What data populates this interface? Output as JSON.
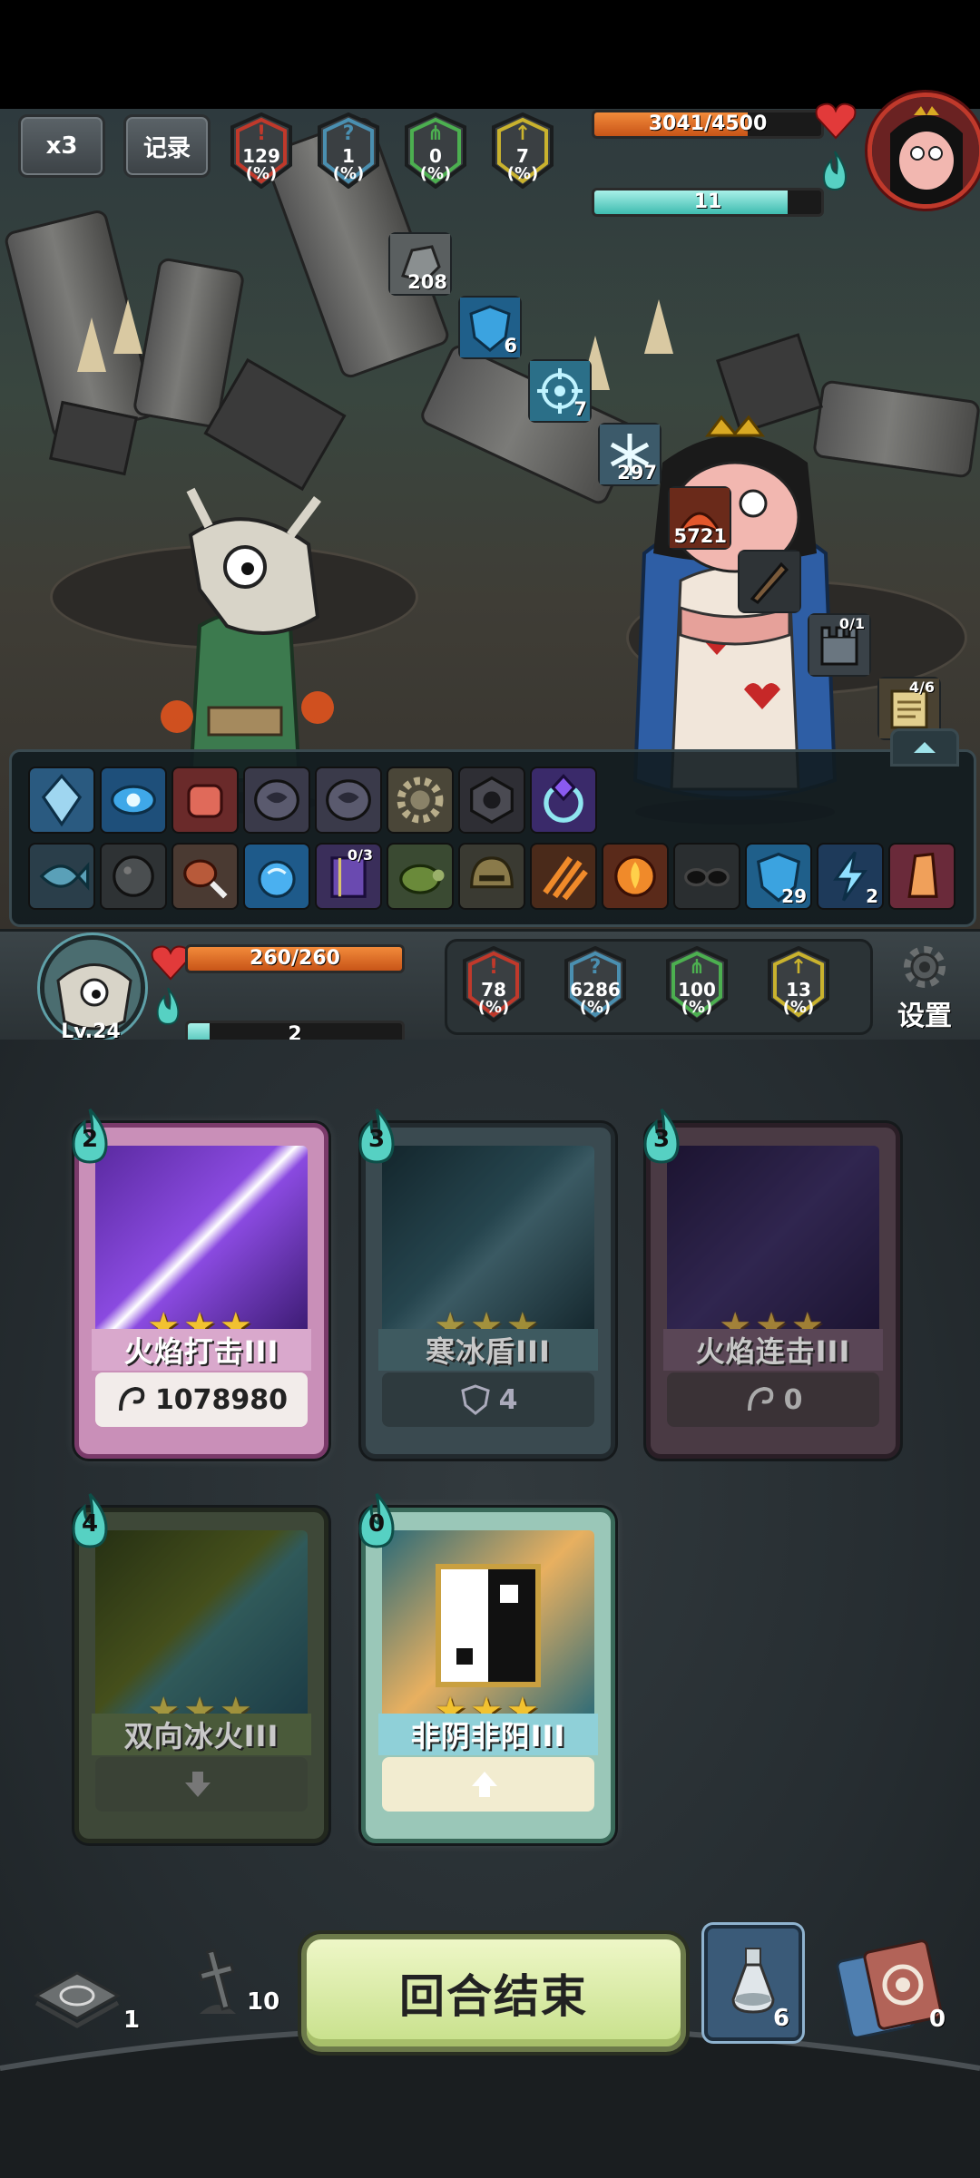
{
  "top": {
    "speed_label": "x3",
    "record_label": "记录",
    "enemy_stats": [
      {
        "value": "129",
        "unit": "(%)",
        "color": "#c0392b"
      },
      {
        "value": "1",
        "unit": "(%)",
        "color": "#4a8fb0"
      },
      {
        "value": "0",
        "unit": "(%)",
        "color": "#4caf50"
      },
      {
        "value": "7",
        "unit": "(%)",
        "color": "#c9b22e"
      }
    ],
    "enemy_hp": "3041/4500",
    "enemy_hp_fraction": 0.676,
    "enemy_energy": "11",
    "enemy_energy_fraction": 0.85,
    "enemy_buffs": [
      {
        "icon": "stone-icon",
        "value": "208",
        "top": ""
      },
      {
        "icon": "shield-icon",
        "value": "6",
        "top": ""
      },
      {
        "icon": "target-icon",
        "value": "7",
        "top": ""
      },
      {
        "icon": "snowflake-icon",
        "value": "297",
        "top": ""
      },
      {
        "icon": "fire-bird-icon",
        "value": "5721",
        "top": ""
      },
      {
        "icon": "dagger-icon",
        "value": "",
        "top": ""
      },
      {
        "icon": "castle-icon",
        "value": "",
        "top": "0/1"
      },
      {
        "icon": "scroll-icon",
        "value": "",
        "top": "4/6"
      }
    ]
  },
  "skills": {
    "row1": [
      "crystal-icon",
      "eye-icon",
      "fist-icon",
      "rune-icon",
      "rune-icon",
      "gear-rune-icon",
      "dark-rune-icon",
      "gem-ring-icon"
    ],
    "row2": [
      {
        "icon": "fish-icon",
        "value": "",
        "top": ""
      },
      {
        "icon": "ball-icon",
        "value": "",
        "top": ""
      },
      {
        "icon": "meat-icon",
        "value": "",
        "top": ""
      },
      {
        "icon": "water-icon",
        "value": "",
        "top": ""
      },
      {
        "icon": "book-icon",
        "value": "",
        "top": "0/3"
      },
      {
        "icon": "turtle-icon",
        "value": "",
        "top": ""
      },
      {
        "icon": "helmet-icon",
        "value": "",
        "top": ""
      },
      {
        "icon": "claw-icon",
        "value": "",
        "top": ""
      },
      {
        "icon": "burn-icon",
        "value": "",
        "top": ""
      },
      {
        "icon": "glasses-icon",
        "value": "",
        "top": ""
      },
      {
        "icon": "shield-icon",
        "value": "29",
        "top": ""
      },
      {
        "icon": "lightning-icon",
        "value": "2",
        "top": ""
      },
      {
        "icon": "crystal-shard-icon",
        "value": "",
        "top": ""
      }
    ]
  },
  "player": {
    "level": "Lv.24",
    "hp": "260/260",
    "hp_fraction": 1.0,
    "energy": "2",
    "energy_fraction": 0.1,
    "stats": [
      {
        "value": "78",
        "unit": "(%)",
        "color": "#c0392b"
      },
      {
        "value": "6286",
        "unit": "(%)",
        "color": "#4a8fb0"
      },
      {
        "value": "100",
        "unit": "(%)",
        "color": "#4caf50"
      },
      {
        "value": "13",
        "unit": "(%)",
        "color": "#c9b22e"
      }
    ],
    "settings_label": "设置"
  },
  "cards": [
    {
      "cost": "2",
      "name": "火焰打击III",
      "stat": "1078980",
      "stat_icon": "fist-icon",
      "theme": "purple"
    },
    {
      "cost": "3",
      "name": "寒冰盾III",
      "stat": "4",
      "stat_icon": "shield-icon",
      "theme": "teal-dim"
    },
    {
      "cost": "3",
      "name": "火焰连击III",
      "stat": "0",
      "stat_icon": "fist-icon",
      "theme": "purple-dim"
    },
    {
      "cost": "4",
      "name": "双向冰火III",
      "stat": "",
      "stat_icon": "arrow-down-icon",
      "theme": "green-dim"
    },
    {
      "cost": "0",
      "name": "非阴非阳III",
      "stat": "",
      "stat_icon": "arrow-up-icon",
      "theme": "teal"
    }
  ],
  "bottom": {
    "draw_pile": "1",
    "grave_count": "10",
    "end_turn_label": "回合结束",
    "potion_count": "6",
    "discard_pile": "0"
  }
}
